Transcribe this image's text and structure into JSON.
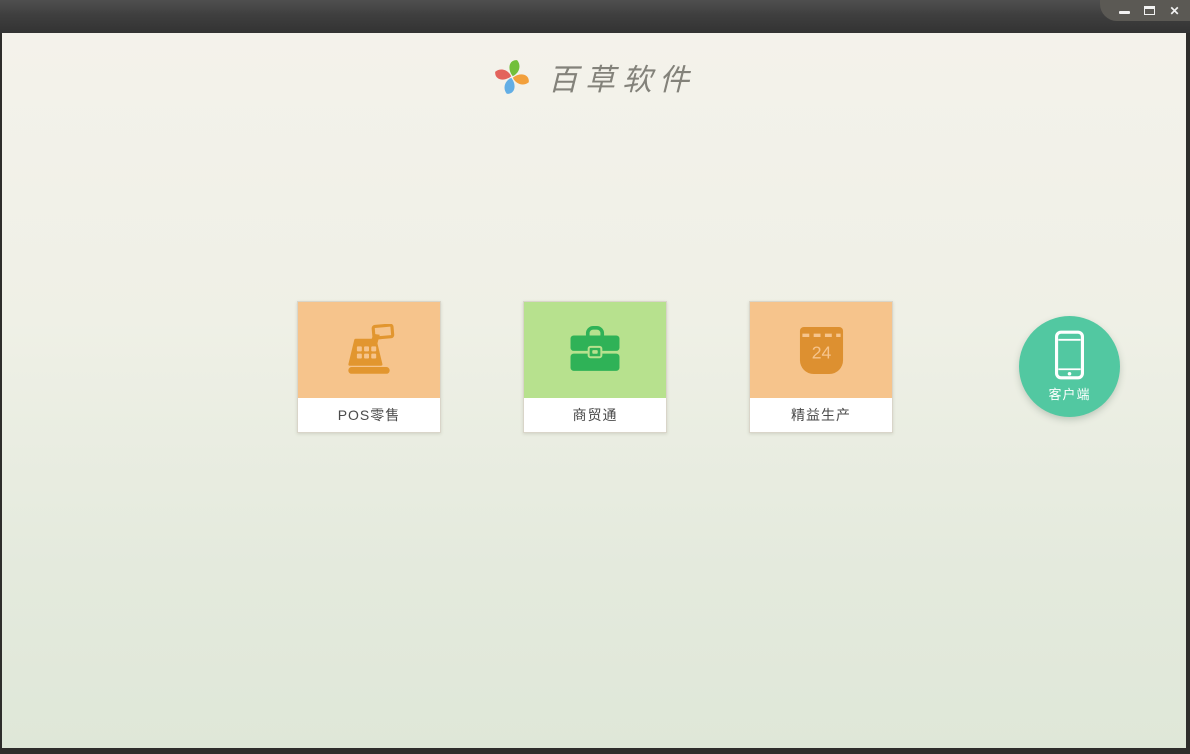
{
  "window": {
    "controls": {
      "close_glyph": "✕"
    }
  },
  "header": {
    "title": "百草软件",
    "logo": "pinwheel-logo",
    "logo_petal_colors": {
      "top": "#72bf3a",
      "right": "#f2a03c",
      "bottom": "#62aee5",
      "left": "#e3635c"
    }
  },
  "products": [
    {
      "label": "POS零售",
      "icon": "cash-register-icon",
      "tile_color": "#f6c48c",
      "icon_color": "#e2962f"
    },
    {
      "label": "商贸通",
      "icon": "briefcase-icon",
      "tile_color": "#b7e18e",
      "icon_color": "#2fb257"
    },
    {
      "label": "精益生产",
      "icon": "calendar-icon",
      "calendar_day": "24",
      "tile_color": "#f6c48c",
      "icon_color": "#dd9030"
    }
  ],
  "client_button": {
    "label": "客户端",
    "icon": "smartphone-icon",
    "color": "#52c8a1"
  },
  "colors": {
    "titlebar_top": "#4f4f4f",
    "titlebar_bottom": "#333333",
    "controls_tab": "#5b5954",
    "background_top": "#f4f2eb",
    "background_bottom": "#dfe7d8",
    "card_border": "#d9d5c9",
    "title_text": "#83827a",
    "card_label_text": "#4a4a4a"
  }
}
